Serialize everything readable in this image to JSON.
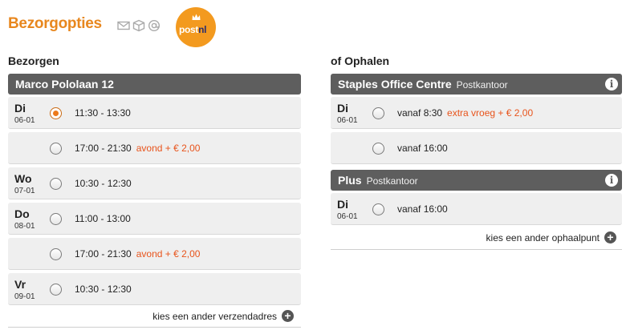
{
  "title": "Bezorgopties",
  "logo": {
    "brand_main": "post",
    "brand_accent": "nl",
    "color": "#f39a1f"
  },
  "icons": [
    "envelope-icon",
    "package-icon",
    "at-icon"
  ],
  "delivery": {
    "heading": "Bezorgen",
    "address": "Marco Pololaan 12",
    "slots": [
      {
        "day": "Di",
        "date": "06-01",
        "time": "11:30 - 13:30",
        "extra": "",
        "selected": true
      },
      {
        "day": "",
        "date": "",
        "time": "17:00 - 21:30",
        "extra": "avond + € 2,00",
        "selected": false
      },
      {
        "day": "Wo",
        "date": "07-01",
        "time": "10:30 - 12:30",
        "extra": "",
        "selected": false
      },
      {
        "day": "Do",
        "date": "08-01",
        "time": "11:00 - 13:00",
        "extra": "",
        "selected": false
      },
      {
        "day": "",
        "date": "",
        "time": "17:00 - 21:30",
        "extra": "avond + € 2,00",
        "selected": false
      },
      {
        "day": "Vr",
        "date": "09-01",
        "time": "10:30 - 12:30",
        "extra": "",
        "selected": false
      }
    ],
    "more_label": "kies een ander verzendadres"
  },
  "pickup": {
    "heading": "of Ophalen",
    "locations": [
      {
        "name": "Staples Office Centre",
        "type": "Postkantoor",
        "slots": [
          {
            "day": "Di",
            "date": "06-01",
            "time": "vanaf 8:30",
            "extra": "extra vroeg + € 2,00",
            "selected": false
          },
          {
            "day": "",
            "date": "",
            "time": "vanaf 16:00",
            "extra": "",
            "selected": false
          }
        ]
      },
      {
        "name": "Plus",
        "type": "Postkantoor",
        "slots": [
          {
            "day": "Di",
            "date": "06-01",
            "time": "vanaf 16:00",
            "extra": "",
            "selected": false
          }
        ]
      }
    ],
    "more_label": "kies een ander ophaalpunt"
  }
}
